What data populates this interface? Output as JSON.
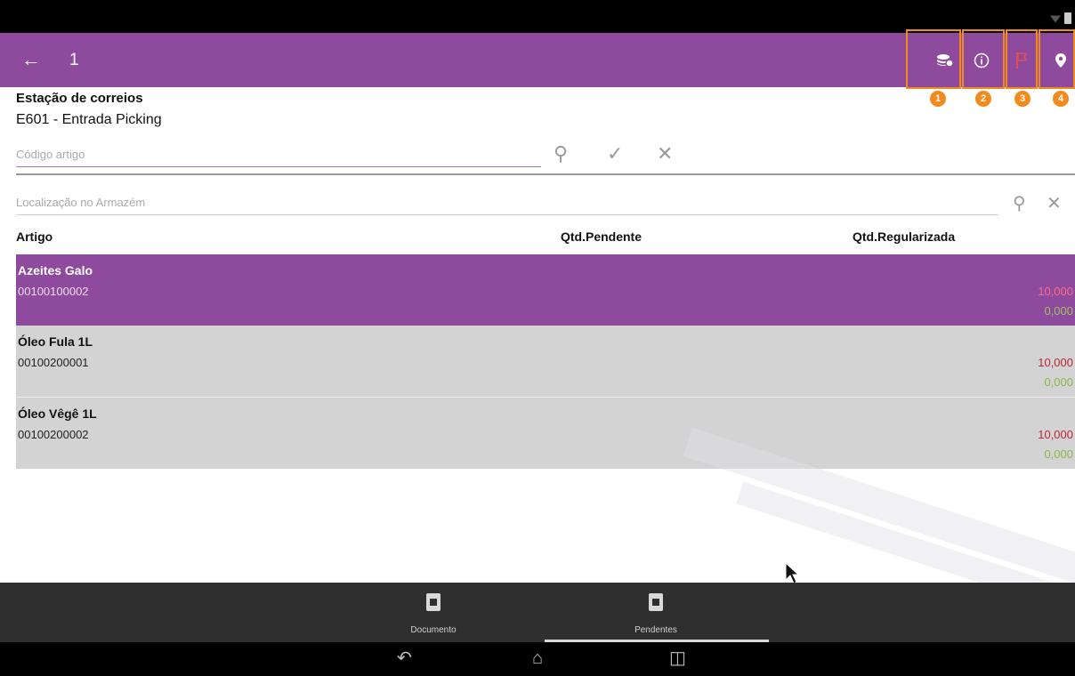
{
  "appbar": {
    "back_icon": "arrow-left-icon",
    "title": "1",
    "actions": [
      {
        "icon": "layers-settings-icon",
        "badge": "1"
      },
      {
        "icon": "info-circle-icon",
        "badge": "2"
      },
      {
        "icon": "flag-icon",
        "badge": "3"
      },
      {
        "icon": "location-pin-icon",
        "badge": "4"
      }
    ]
  },
  "station": {
    "label": "Estação de correios",
    "value": "E601 - Entrada Picking"
  },
  "article_search": {
    "placeholder": "Código artigo"
  },
  "location_search": {
    "placeholder": "Localização no Armazém"
  },
  "table": {
    "columns": [
      "Artigo",
      "Qtd.Pendente",
      "Qtd.Regularizada"
    ],
    "rows": [
      {
        "name": "Azeites Galo",
        "code": "00100100002",
        "qty_pending": "10,000",
        "qty_regularized": "0,000",
        "selected": true
      },
      {
        "name": "Óleo Fula 1L",
        "code": "00100200001",
        "qty_pending": "10,000",
        "qty_regularized": "0,000",
        "selected": false
      },
      {
        "name": "Óleo Vêgê 1L",
        "code": "00100200002",
        "qty_pending": "10,000",
        "qty_regularized": "0,000",
        "selected": false
      }
    ]
  },
  "tabs": [
    {
      "label": "Documento",
      "icon": "clipboard-check-icon"
    },
    {
      "label": "Pendentes",
      "icon": "clipboard-alert-icon",
      "active": true
    }
  ],
  "colors": {
    "accent": "#8e4a9c",
    "highlight": "#f28a1e",
    "pending": "#c0243a",
    "regularized": "#8bb84a"
  }
}
